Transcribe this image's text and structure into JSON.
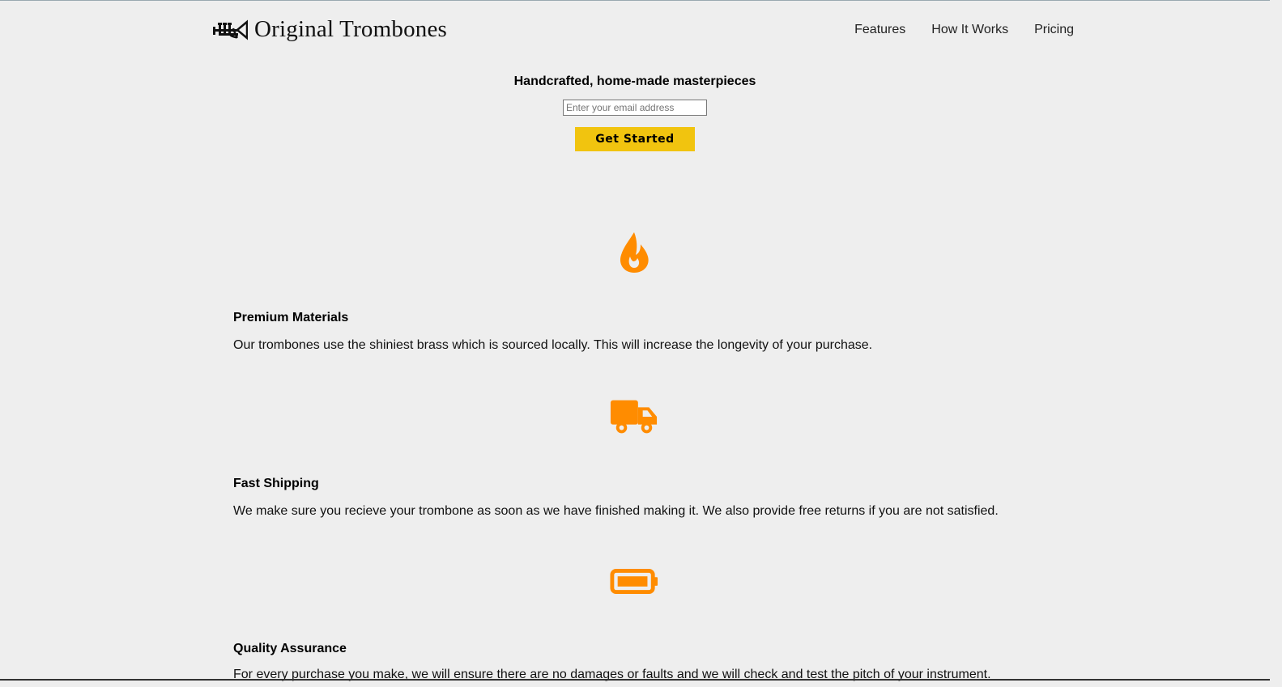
{
  "header": {
    "brand": "Original Trombones",
    "nav": [
      {
        "label": "Features"
      },
      {
        "label": "How It Works"
      },
      {
        "label": "Pricing"
      }
    ]
  },
  "hero": {
    "heading": "Handcrafted, home-made masterpieces",
    "email_placeholder": "Enter your email address",
    "cta_label": "Get Started"
  },
  "features": [
    {
      "icon": "fire-icon",
      "title": "Premium Materials",
      "description": "Our trombones use the shiniest brass which is sourced locally. This will increase the longevity of your purchase."
    },
    {
      "icon": "truck-icon",
      "title": "Fast Shipping",
      "description": "We make sure you recieve your trombone as soon as we have finished making it. We also provide free returns if you are not satisfied."
    },
    {
      "icon": "battery-full-icon",
      "title": "Quality Assurance",
      "description": "For every purchase you make, we will ensure there are no damages or faults and we will check and test the pitch of your instrument."
    }
  ],
  "colors": {
    "accent": "#ff8c00",
    "cta": "#f1c40f",
    "background": "#eeeeee"
  }
}
